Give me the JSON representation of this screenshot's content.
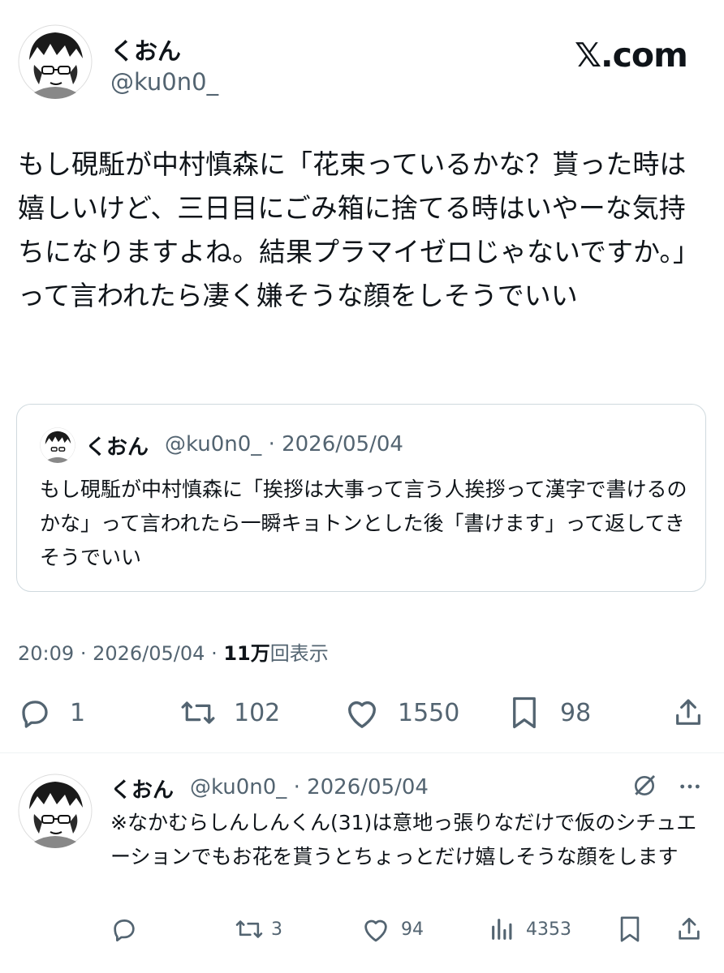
{
  "brand": {
    "logo_text": "𝕏.com"
  },
  "author": {
    "display_name": "くおん",
    "handle": "@ku0n0_"
  },
  "post": {
    "text": "もし硯駈が中村慎森に「花束っているかな？貰った時は嬉しいけど、三日目にごみ箱に捨てる時はいやーな気持ちになりますよね。結果プラマイゼロじゃないですか。」って言われたら凄く嫌そうな顔をしそうでいい",
    "time": "20:09",
    "date": "2026/05/04",
    "views_count": "11万",
    "views_label": "回表示",
    "stats": {
      "replies": "1",
      "reposts": "102",
      "likes": "1550",
      "bookmarks": "98"
    }
  },
  "quoted": {
    "display_name": "くおん",
    "meta": "@ku0n0_ · 2026/05/04",
    "text": "もし硯駈が中村慎森に「挨拶は大事って言う人挨拶って漢字で書けるのかな」って言われたら一瞬キョトンとした後「書けます」って返してきそうでいい"
  },
  "reply": {
    "display_name": "くおん",
    "meta": "@ku0n0_ · 2026/05/04",
    "text": "※なかむらしんしんくん(31)は意地っ張りなだけで仮のシチュエーションでもお花を貰うとちょっとだけ嬉しそうな顔をします",
    "stats": {
      "replies": "",
      "reposts": "3",
      "likes": "94",
      "views": "4353"
    }
  },
  "icons": [
    "avatar",
    "grok-icon",
    "more-icon",
    "reply-icon",
    "repost-icon",
    "like-icon",
    "bookmark-icon",
    "share-icon",
    "views-icon"
  ]
}
